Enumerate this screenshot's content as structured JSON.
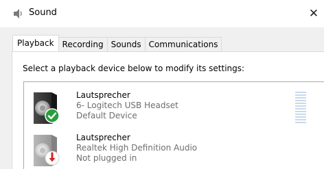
{
  "window": {
    "title": "Sound",
    "close_symbol": "✕"
  },
  "tabs": [
    {
      "label": "Playback",
      "active": true
    },
    {
      "label": "Recording",
      "active": false
    },
    {
      "label": "Sounds",
      "active": false
    },
    {
      "label": "Communications",
      "active": false
    }
  ],
  "instruction": "Select a playback device below to modify its settings:",
  "devices": [
    {
      "name": "Lautsprecher",
      "description": "6- Logitech USB Headset",
      "status": "Default Device",
      "badge_icon": "green-check-icon",
      "device_icon": "speaker-icon"
    },
    {
      "name": "Lautsprecher",
      "description": "Realtek High Definition Audio",
      "status": "Not plugged in",
      "badge_icon": "red-down-arrow-icon",
      "device_icon": "speaker-icon"
    }
  ],
  "colors": {
    "dialog_bg": "#f0f0f0",
    "border": "#d9d9d9",
    "secondary_text": "#6d6d6d",
    "default_badge": "#2a9d3e",
    "unplugged_badge": "#d42424",
    "level_meter": "#c9d9ec"
  }
}
